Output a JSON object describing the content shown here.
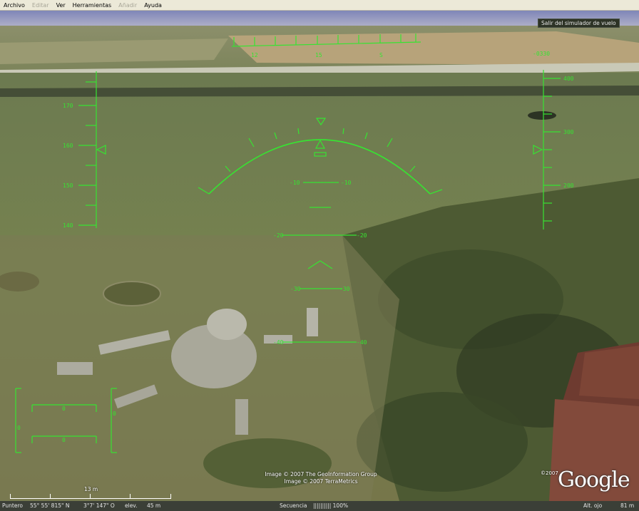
{
  "menu": {
    "items": [
      {
        "label": "Archivo",
        "enabled": true
      },
      {
        "label": "Editar",
        "enabled": false
      },
      {
        "label": "Ver",
        "enabled": true
      },
      {
        "label": "Herramientas",
        "enabled": true
      },
      {
        "label": "Añadir",
        "enabled": false
      },
      {
        "label": "Ayuda",
        "enabled": true
      }
    ]
  },
  "flight": {
    "exit_label": "Salir del simulador de vuelo",
    "hud_color": "#37e332",
    "heading_labels": [
      "12",
      "15",
      "S"
    ],
    "vertical_speed": "-0330",
    "speed_labels": [
      "170",
      "160",
      "150",
      "140"
    ],
    "altitude_labels": [
      "400",
      "300",
      "200"
    ],
    "pitch_labels": [
      {
        "left": "-10",
        "right": "-10"
      },
      {
        "left": "-20",
        "right": "-20"
      },
      {
        "left": "-30",
        "right": "-30"
      },
      {
        "left": "-40",
        "right": "-40"
      }
    ],
    "gauge_labels": {
      "left": "0",
      "middle": "0",
      "right": "0",
      "side": "0"
    }
  },
  "imagery": {
    "credit_line_1": "Image © 2007 The GeoInformation Group",
    "credit_line_2": "Image © 2007 TerraMetrics",
    "logo_copyright": "©2007",
    "logo_word": "Google"
  },
  "scale_bar": {
    "label": "13 m"
  },
  "status": {
    "pointer_label": "Puntero",
    "lat": "55° 55' 815\" N",
    "lon": "3°7' 147\" O",
    "elev_label": "elev.",
    "elev_value": "45 m",
    "stream_label": "Secuencia",
    "stream_value": "|||||||||| 100%",
    "eye_label": "Alt. ojo",
    "eye_value": "81 m"
  }
}
